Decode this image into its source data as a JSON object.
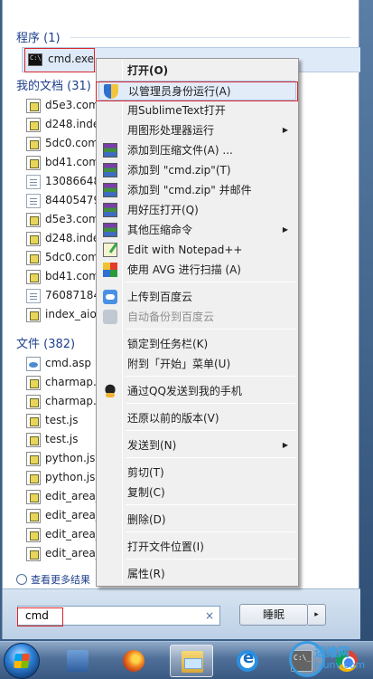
{
  "start_menu": {
    "programs": {
      "title": "程序 (1)",
      "items": [
        {
          "label": "cmd.exe",
          "icon": "cmd-icon"
        }
      ]
    },
    "documents": {
      "title": "我的文档 (31)",
      "items": [
        {
          "label": "d5e3.com",
          "icon": "js-file-icon"
        },
        {
          "label": "d248.index",
          "icon": "js-file-icon"
        },
        {
          "label": "5dc0.com",
          "icon": "js-file-icon"
        },
        {
          "label": "bd41.com",
          "icon": "js-file-icon"
        },
        {
          "label": "13086648",
          "icon": "document-icon"
        },
        {
          "label": "84405479",
          "icon": "document-icon"
        },
        {
          "label": "d5e3.com",
          "icon": "js-file-icon"
        },
        {
          "label": "d248.index",
          "icon": "js-file-icon"
        },
        {
          "label": "5dc0.com",
          "icon": "js-file-icon"
        },
        {
          "label": "bd41.com",
          "icon": "js-file-icon"
        },
        {
          "label": "76087184",
          "icon": "document-icon"
        },
        {
          "label": "index_aio_",
          "icon": "js-file-icon"
        }
      ]
    },
    "files": {
      "title": "文件 (382)",
      "items": [
        {
          "label": "cmd.asp",
          "icon": "asp-file-icon"
        },
        {
          "label": "charmap.",
          "icon": "js-file-icon"
        },
        {
          "label": "charmap.",
          "icon": "js-file-icon"
        },
        {
          "label": "test.js",
          "icon": "js-file-icon"
        },
        {
          "label": "test.js",
          "icon": "js-file-icon"
        },
        {
          "label": "python.js",
          "icon": "js-file-icon"
        },
        {
          "label": "python.js",
          "icon": "js-file-icon"
        },
        {
          "label": "edit_area_",
          "icon": "js-file-icon"
        },
        {
          "label": "edit_area_",
          "icon": "js-file-icon"
        },
        {
          "label": "edit_area_",
          "icon": "js-file-icon"
        },
        {
          "label": "edit_area_",
          "icon": "js-file-icon"
        }
      ]
    },
    "see_more": "查看更多结果",
    "search": {
      "value": "cmd",
      "clear_symbol": "×"
    },
    "sleep_label": "睡眠",
    "sleep_arrow": "▸"
  },
  "context_menu": {
    "sections": [
      [
        {
          "label": "打开(O)",
          "bold": true
        },
        {
          "label": "以管理员身份运行(A)",
          "icon": "uac-shield-icon",
          "highlighted": true
        },
        {
          "label": "用SublimeText打开"
        },
        {
          "label": "用图形处理器运行",
          "submenu": true
        },
        {
          "label": "添加到压缩文件(A) ...",
          "icon": "winrar-icon"
        },
        {
          "label": "添加到 \"cmd.zip\"(T)",
          "icon": "winrar-icon"
        },
        {
          "label": "添加到 \"cmd.zip\" 并邮件",
          "icon": "winrar-icon"
        },
        {
          "label": "用好压打开(Q)",
          "icon": "winrar-icon"
        },
        {
          "label": "其他压缩命令",
          "icon": "winrar-icon",
          "submenu": true
        },
        {
          "label": "Edit with Notepad++",
          "icon": "notepad-icon"
        },
        {
          "label": "使用 AVG 进行扫描 (A)",
          "icon": "avg-icon"
        }
      ],
      [
        {
          "label": "上传到百度云",
          "icon": "baidu-cloud-icon"
        },
        {
          "label": "自动备份到百度云",
          "icon": "baidu-cloud-disabled-icon",
          "disabled": true
        }
      ],
      [
        {
          "label": "锁定到任务栏(K)"
        },
        {
          "label": "附到「开始」菜单(U)"
        }
      ],
      [
        {
          "label": "通过QQ发送到我的手机",
          "icon": "qq-icon"
        }
      ],
      [
        {
          "label": "还原以前的版本(V)"
        }
      ],
      [
        {
          "label": "发送到(N)",
          "submenu": true
        }
      ],
      [
        {
          "label": "剪切(T)"
        },
        {
          "label": "复制(C)"
        }
      ],
      [
        {
          "label": "删除(D)"
        }
      ],
      [
        {
          "label": "打开文件位置(I)"
        }
      ],
      [
        {
          "label": "属性(R)"
        }
      ]
    ],
    "submenu_arrow": "▶"
  },
  "taskbar": {
    "buttons": [
      {
        "name": "start-button",
        "icon": "windows-orb-icon"
      },
      {
        "name": "network-app",
        "icon": "network-icon"
      },
      {
        "name": "firefox",
        "icon": "firefox-icon"
      },
      {
        "name": "explorer",
        "icon": "folder-icon",
        "active": true
      },
      {
        "name": "ie",
        "icon": "ie-icon"
      },
      {
        "name": "cmd",
        "icon": "cmd-icon"
      },
      {
        "name": "chrome",
        "icon": "chrome-icon"
      }
    ]
  },
  "watermark": {
    "line1": "运维网",
    "line2": "iyunv.com"
  },
  "colors": {
    "accent": "#1d3f8c",
    "highlight_box": "#d9262c",
    "menu_bg": "#f0f0f0"
  }
}
